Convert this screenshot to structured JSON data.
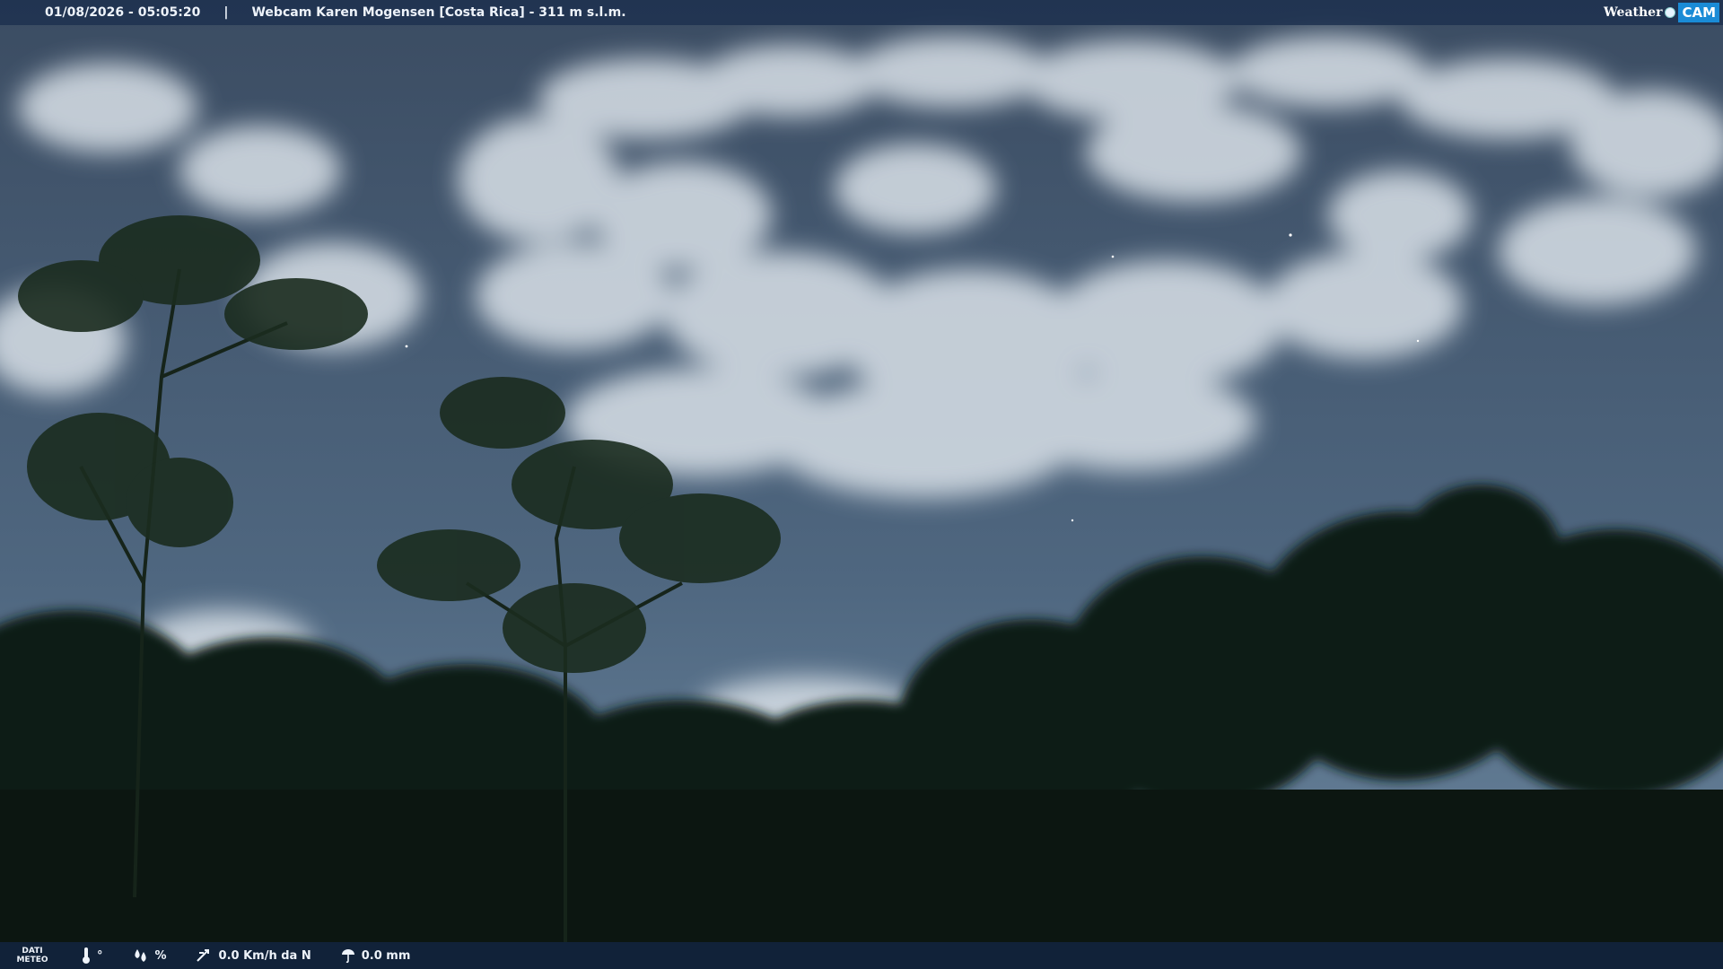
{
  "header": {
    "datetime": "01/08/2026 - 05:05:20",
    "separator": "|",
    "webcam_title": "Webcam Karen Mogensen [Costa Rica]  - 311 m s.l.m.",
    "brand_weather": "Weather",
    "brand_cam": "CAM"
  },
  "footer": {
    "dati_line1": "DATI",
    "dati_line2": "METEO",
    "temperature": "°",
    "humidity": "%",
    "wind": "0.0 Km/h da N",
    "rain": "0.0 mm"
  },
  "colors": {
    "sky_top": "#3b4c62",
    "sky_bottom": "#5d7891",
    "cloud": "#d9e1e8",
    "forest": "#0e1a14",
    "bar": "#1c304e",
    "brand_accent": "#1a8bd6"
  }
}
